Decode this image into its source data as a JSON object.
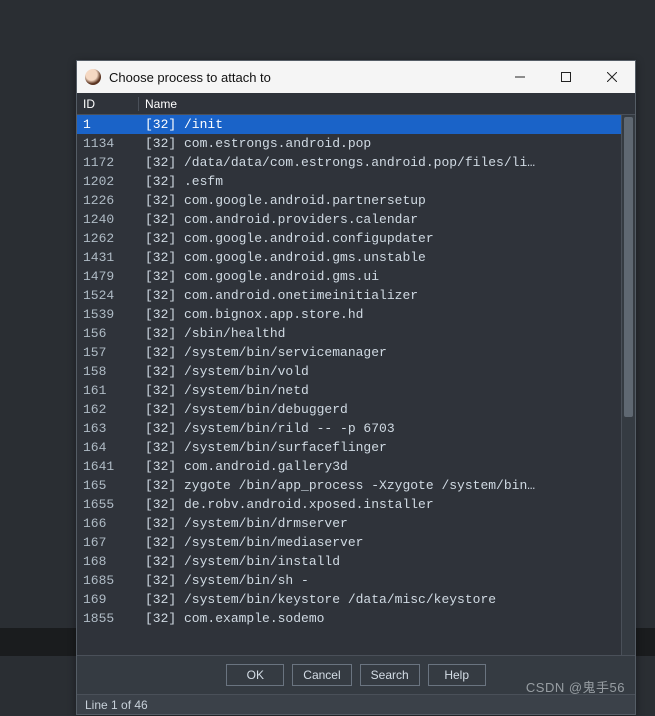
{
  "window": {
    "title": "Choose process to attach to"
  },
  "headers": {
    "id": "ID",
    "name": "Name"
  },
  "rows": [
    {
      "id": "1",
      "name": "[32] /init",
      "selected": true
    },
    {
      "id": "1134",
      "name": "[32] com.estrongs.android.pop"
    },
    {
      "id": "1172",
      "name": "[32] /data/data/com.estrongs.android.pop/files/li…"
    },
    {
      "id": "1202",
      "name": "[32] .esfm"
    },
    {
      "id": "1226",
      "name": "[32] com.google.android.partnersetup"
    },
    {
      "id": "1240",
      "name": "[32] com.android.providers.calendar"
    },
    {
      "id": "1262",
      "name": "[32] com.google.android.configupdater"
    },
    {
      "id": "1431",
      "name": "[32] com.google.android.gms.unstable"
    },
    {
      "id": "1479",
      "name": "[32] com.google.android.gms.ui"
    },
    {
      "id": "1524",
      "name": "[32] com.android.onetimeinitializer"
    },
    {
      "id": "1539",
      "name": "[32] com.bignox.app.store.hd"
    },
    {
      "id": "156",
      "name": "[32] /sbin/healthd"
    },
    {
      "id": "157",
      "name": "[32] /system/bin/servicemanager"
    },
    {
      "id": "158",
      "name": "[32] /system/bin/vold"
    },
    {
      "id": "161",
      "name": "[32] /system/bin/netd"
    },
    {
      "id": "162",
      "name": "[32] /system/bin/debuggerd"
    },
    {
      "id": "163",
      "name": "[32] /system/bin/rild -- -p 6703"
    },
    {
      "id": "164",
      "name": "[32] /system/bin/surfaceflinger"
    },
    {
      "id": "1641",
      "name": "[32] com.android.gallery3d"
    },
    {
      "id": "165",
      "name": "[32] zygote /bin/app_process -Xzygote /system/bin…"
    },
    {
      "id": "1655",
      "name": "[32] de.robv.android.xposed.installer"
    },
    {
      "id": "166",
      "name": "[32] /system/bin/drmserver"
    },
    {
      "id": "167",
      "name": "[32] /system/bin/mediaserver"
    },
    {
      "id": "168",
      "name": "[32] /system/bin/installd"
    },
    {
      "id": "1685",
      "name": "[32] /system/bin/sh -"
    },
    {
      "id": "169",
      "name": "[32] /system/bin/keystore /data/misc/keystore"
    },
    {
      "id": "1855",
      "name": "[32] com.example.sodemo"
    }
  ],
  "buttons": {
    "ok": "OK",
    "cancel": "Cancel",
    "search": "Search",
    "help": "Help"
  },
  "status": "Line 1 of 46",
  "watermark": "CSDN @鬼手56"
}
